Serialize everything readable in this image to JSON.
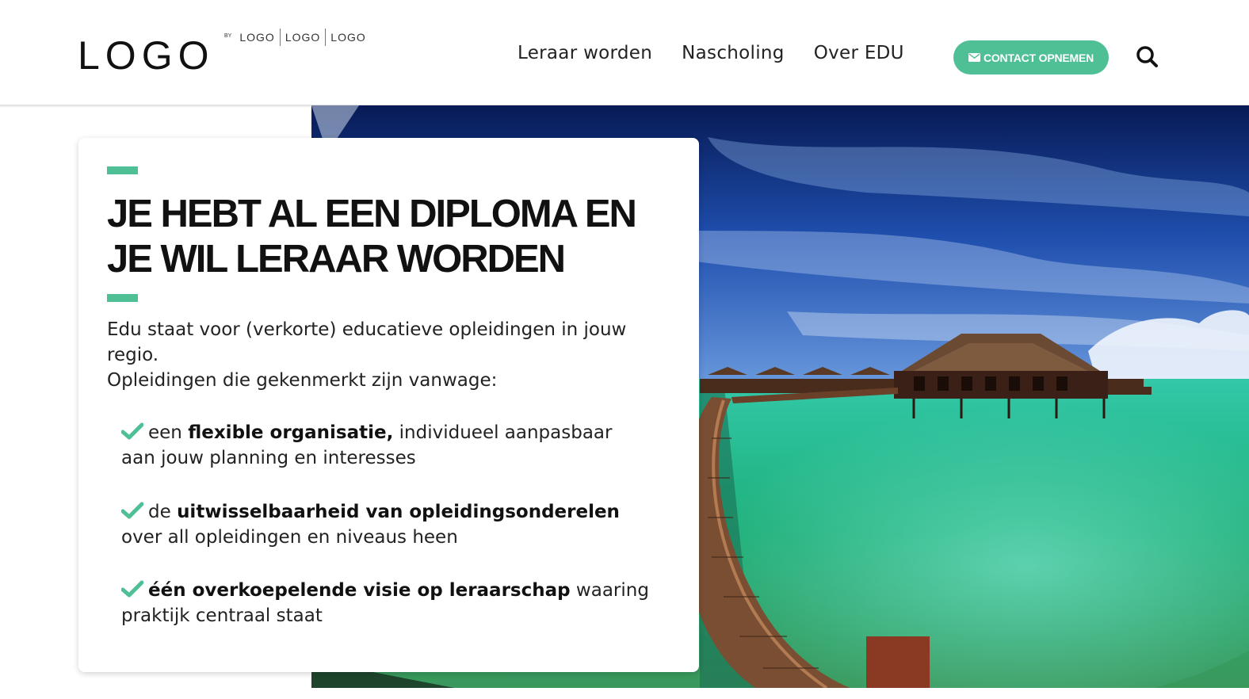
{
  "header": {
    "logo_main": "LOGO",
    "logo_by": "BY",
    "logo_subs": [
      "LOGO",
      "LOGO",
      "LOGO"
    ],
    "nav": [
      "Leraar worden",
      "Nascholing",
      "Over EDU"
    ],
    "contact_label": "CONTACT OPNEMEN",
    "contact_icon": "envelope-icon",
    "search_icon": "search-icon"
  },
  "hero": {
    "image": "tropical-overwater-bungalow-photo",
    "title_lines": [
      "JE HEBT AL EEN DIPLOMA EN",
      "JE WIL LERAAR WORDEN"
    ],
    "intro_lines": [
      "Edu staat voor (verkorte) educatieve opleidingen in jouw",
      "regio.",
      "Opleidingen die gekenmerkt zijn vanwage:"
    ],
    "features": [
      {
        "pre": "een ",
        "bold": "flexible organisatie,",
        "post": " individueel aanpasbaar",
        "line2": "aan jouw planning en interesses"
      },
      {
        "pre": "de ",
        "bold": "uitwisselbaarheid van opleidingsonderelen",
        "post": "",
        "line2": "over all opleidingen en niveaus heen"
      },
      {
        "pre": "",
        "bold": "één overkoepelende visie op leraarschap",
        "post": " waaring",
        "line2": "praktijk centraal staat"
      }
    ]
  },
  "colors": {
    "accent": "#4fbf96",
    "text": "#111111"
  }
}
